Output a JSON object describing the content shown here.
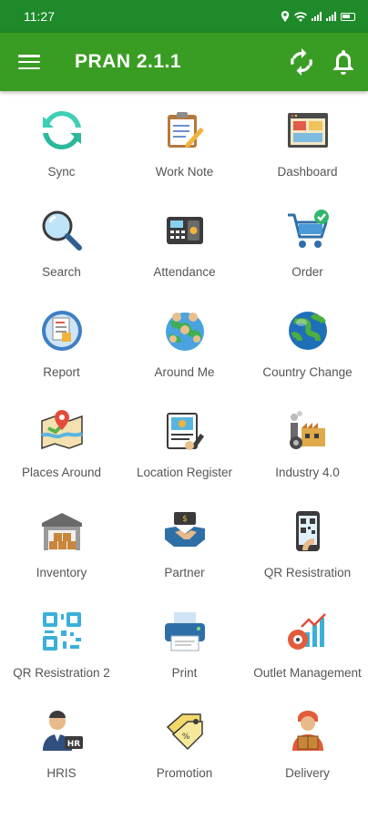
{
  "status_bar": {
    "time": "11:27"
  },
  "app_bar": {
    "title": "PRAN 2.1.1"
  },
  "tiles": [
    {
      "label": "Sync",
      "icon": "sync-icon"
    },
    {
      "label": "Work Note",
      "icon": "work-note-icon"
    },
    {
      "label": "Dashboard",
      "icon": "dashboard-icon"
    },
    {
      "label": "Search",
      "icon": "search-icon"
    },
    {
      "label": "Attendance",
      "icon": "attendance-icon"
    },
    {
      "label": "Order",
      "icon": "order-cart-icon"
    },
    {
      "label": "Report",
      "icon": "report-icon"
    },
    {
      "label": "Around Me",
      "icon": "around-me-globe-icon"
    },
    {
      "label": "Country Change",
      "icon": "country-globe-icon"
    },
    {
      "label": "Places Around",
      "icon": "map-pin-icon"
    },
    {
      "label": "Location Register",
      "icon": "location-register-icon"
    },
    {
      "label": "Industry 4.0",
      "icon": "industry-icon"
    },
    {
      "label": "Inventory",
      "icon": "inventory-warehouse-icon"
    },
    {
      "label": "Partner",
      "icon": "partner-handshake-icon"
    },
    {
      "label": "QR Resistration",
      "icon": "qr-phone-icon"
    },
    {
      "label": "QR Resistration 2",
      "icon": "qr-code-icon"
    },
    {
      "label": "Print",
      "icon": "printer-icon"
    },
    {
      "label": "Outlet Management",
      "icon": "outlet-management-icon"
    },
    {
      "label": "HRIS",
      "icon": "hris-person-icon"
    },
    {
      "label": "Promotion",
      "icon": "promotion-tag-icon"
    },
    {
      "label": "Delivery",
      "icon": "delivery-person-icon"
    }
  ],
  "colors": {
    "status_bar": "#1e8a2a",
    "app_bar": "#3a9d23",
    "label": "#555555"
  }
}
